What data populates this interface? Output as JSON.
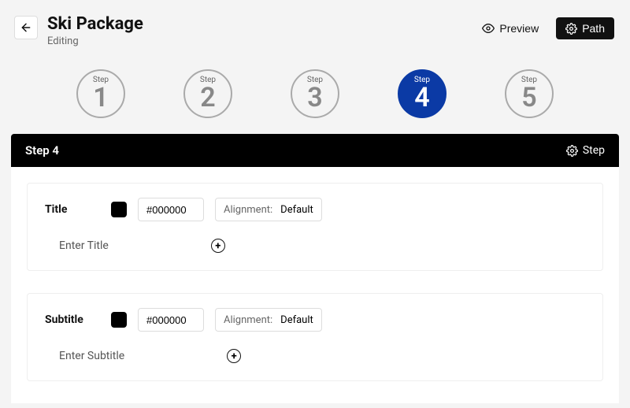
{
  "header": {
    "title": "Ski Package",
    "subtitle": "Editing",
    "preview_label": "Preview",
    "path_label": "Path"
  },
  "stepper": {
    "step_word": "Step",
    "items": [
      {
        "num": "1",
        "active": false
      },
      {
        "num": "2",
        "active": false
      },
      {
        "num": "3",
        "active": false
      },
      {
        "num": "4",
        "active": true
      },
      {
        "num": "5",
        "active": false
      }
    ]
  },
  "panel": {
    "title": "Step 4",
    "step_btn": "Step"
  },
  "title_card": {
    "label": "Title",
    "color": "#000000",
    "alignment_prefix": "Alignment:",
    "alignment_value": "Default",
    "placeholder": "Enter Title"
  },
  "subtitle_card": {
    "label": "Subtitle",
    "color": "#000000",
    "alignment_prefix": "Alignment:",
    "alignment_value": "Default",
    "placeholder": "Enter Subtitle"
  }
}
